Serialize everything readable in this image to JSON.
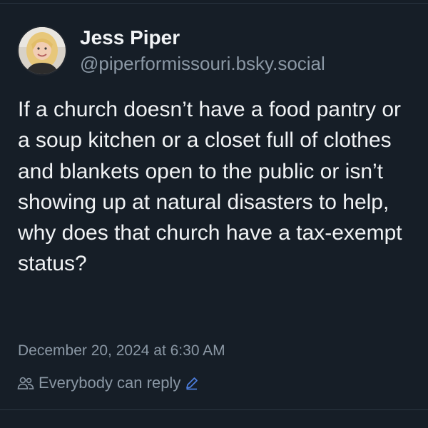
{
  "author": {
    "display_name": "Jess Piper",
    "handle": "@piperformissouri.bsky.social",
    "avatar_icon": "user-avatar-photo"
  },
  "post": {
    "text": "If a church doesn’t have a food pantry or a soup kitchen or a closet full of clothes and blankets open to the public or isn’t showing up at natural disasters to help, why does that church have a tax-exempt status?",
    "timestamp": "December 20, 2024 at 6:30 AM",
    "reply_setting": "Everybody can reply"
  },
  "colors": {
    "background": "#161e27",
    "text": "#f1f3f5",
    "muted": "#8b98a5",
    "accent": "#4d7fe0"
  }
}
